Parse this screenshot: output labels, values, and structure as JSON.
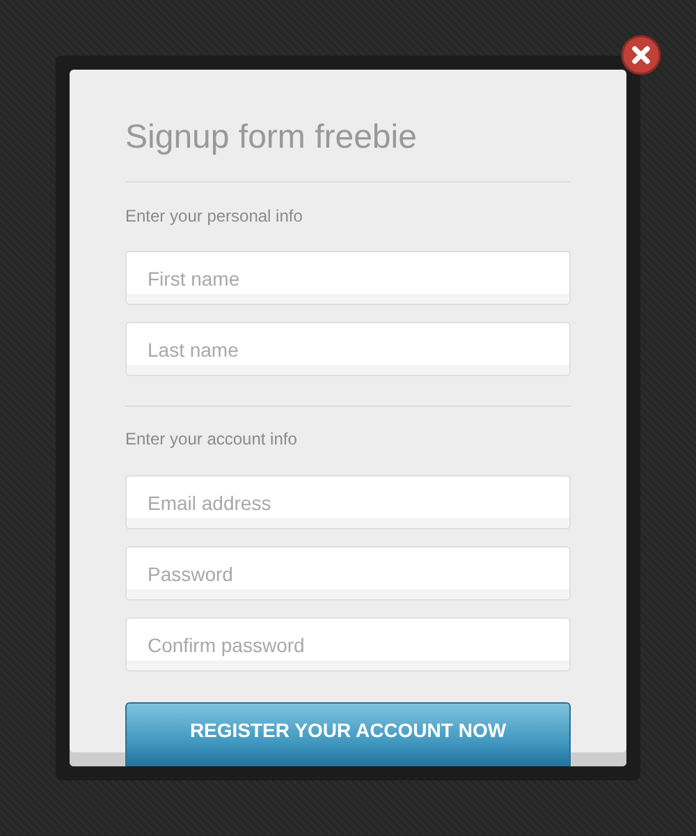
{
  "title": "Signup form freebie",
  "sections": [
    {
      "label": "Enter your personal info",
      "fields": [
        {
          "placeholder": "First name"
        },
        {
          "placeholder": "Last name"
        }
      ]
    },
    {
      "label": "Enter your account info",
      "fields": [
        {
          "placeholder": "Email address"
        },
        {
          "placeholder": "Password"
        },
        {
          "placeholder": "Confirm password"
        }
      ]
    }
  ],
  "button": "REGISTER YOUR ACCOUNT NOW"
}
